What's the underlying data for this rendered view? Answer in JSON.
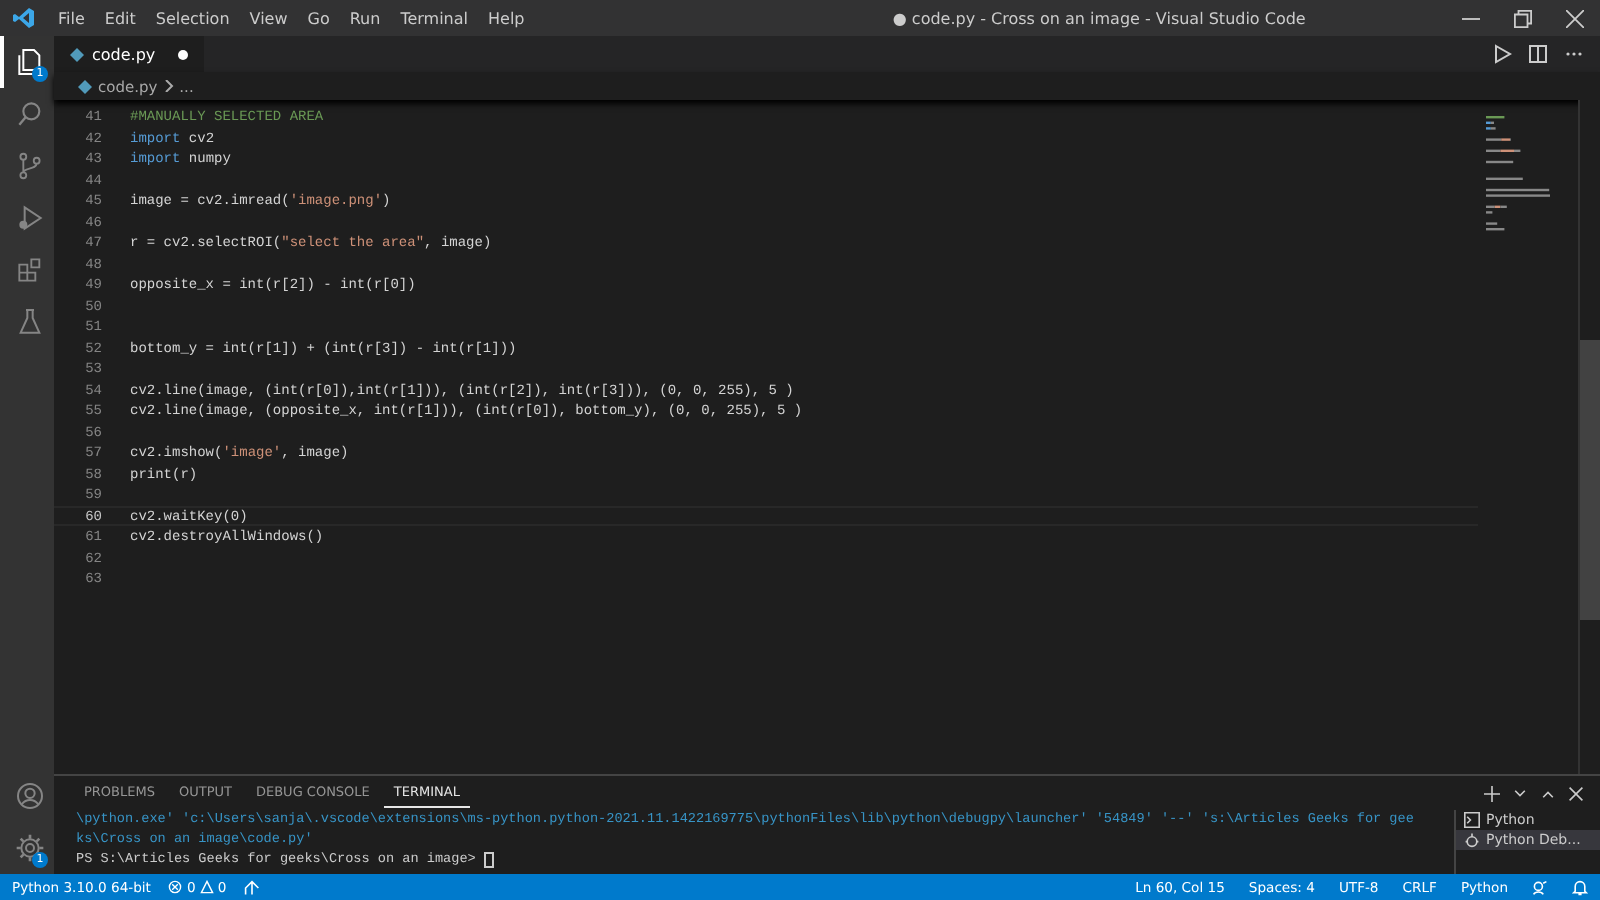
{
  "window": {
    "title": "● code.py - Cross on an image - Visual Studio Code"
  },
  "menu": [
    "File",
    "Edit",
    "Selection",
    "View",
    "Go",
    "Run",
    "Terminal",
    "Help"
  ],
  "activity_bar": {
    "items": [
      {
        "kind": "explorer",
        "badge": "1",
        "selected": true
      },
      {
        "kind": "search",
        "selected": false
      },
      {
        "kind": "source-control",
        "selected": false
      },
      {
        "kind": "run",
        "selected": false
      },
      {
        "kind": "extensions",
        "selected": false
      },
      {
        "kind": "testing",
        "selected": false
      }
    ],
    "bottom": [
      {
        "kind": "account"
      },
      {
        "kind": "settings",
        "badge": "1"
      }
    ]
  },
  "tabs": [
    {
      "label": "code.py",
      "selected": true,
      "modified": true
    }
  ],
  "breadcrumb": [
    "code.py",
    "..."
  ],
  "editor": {
    "lines": [
      {
        "number": "41",
        "current": false,
        "tokens": [
          {
            "text": "#MANUALLY SELECTED AREA",
            "kind": "comment"
          }
        ]
      },
      {
        "number": "42",
        "current": false,
        "tokens": [
          {
            "text": "import",
            "kind": "keyword"
          },
          {
            "text": " cv2",
            "kind": "plain"
          }
        ]
      },
      {
        "number": "43",
        "current": false,
        "tokens": [
          {
            "text": "import",
            "kind": "keyword"
          },
          {
            "text": " numpy",
            "kind": "plain"
          }
        ]
      },
      {
        "number": "44",
        "current": false
      },
      {
        "number": "45",
        "current": false,
        "tokens": [
          {
            "text": "image = cv2.imread(",
            "kind": "plain"
          },
          {
            "text": "'image.png'",
            "kind": "string"
          },
          {
            "text": ")",
            "kind": "plain"
          }
        ]
      },
      {
        "number": "46",
        "current": false
      },
      {
        "number": "47",
        "current": false,
        "tokens": [
          {
            "text": "r = cv2.selectROI(",
            "kind": "plain"
          },
          {
            "text": "\"select the area\"",
            "kind": "string"
          },
          {
            "text": ", image)",
            "kind": "plain"
          }
        ]
      },
      {
        "number": "48",
        "current": false
      },
      {
        "number": "49",
        "current": false,
        "tokens": [
          {
            "text": "opposite_x = int(r[2]) - int(r[0])",
            "kind": "plain"
          }
        ]
      },
      {
        "number": "50",
        "current": false
      },
      {
        "number": "51",
        "current": false
      },
      {
        "number": "52",
        "current": false,
        "tokens": [
          {
            "text": "bottom_y = int(r[1]) + (int(r[3]) - int(r[1]))",
            "kind": "plain"
          }
        ]
      },
      {
        "number": "53",
        "current": false
      },
      {
        "number": "54",
        "current": false,
        "tokens": [
          {
            "text": "cv2.line(image, (int(r[0]),int(r[1])), (int(r[2]), int(r[3])), (0, 0, 255), 5 )",
            "kind": "plain"
          }
        ]
      },
      {
        "number": "55",
        "current": false,
        "tokens": [
          {
            "text": "cv2.line(image, (opposite_x, int(r[1])), (int(r[0]), bottom_y), (0, 0, 255), 5 )",
            "kind": "plain"
          }
        ]
      },
      {
        "number": "56",
        "current": false
      },
      {
        "number": "57",
        "current": false,
        "tokens": [
          {
            "text": "cv2.imshow(",
            "kind": "plain"
          },
          {
            "text": "'image'",
            "kind": "string"
          },
          {
            "text": ", image)",
            "kind": "plain"
          }
        ]
      },
      {
        "number": "58",
        "current": false,
        "tokens": [
          {
            "text": "print(r)",
            "kind": "plain"
          }
        ]
      },
      {
        "number": "59",
        "current": false
      },
      {
        "number": "60",
        "current": true,
        "tokens": [
          {
            "text": "cv2.waitKey(0)",
            "kind": "plain"
          }
        ]
      },
      {
        "number": "61",
        "current": false,
        "tokens": [
          {
            "text": "cv2.destroyAllWindows()",
            "kind": "plain"
          }
        ]
      },
      {
        "number": "62",
        "current": false
      },
      {
        "number": "63",
        "current": false
      }
    ]
  },
  "panel": {
    "tabs": [
      {
        "label": "PROBLEMS",
        "selected": false
      },
      {
        "label": "OUTPUT",
        "selected": false
      },
      {
        "label": "DEBUG CONSOLE",
        "selected": false
      },
      {
        "label": "TERMINAL",
        "selected": true
      }
    ],
    "terminal_lines": [
      {
        "text": "\\python.exe' 'c:\\Users\\sanja\\.vscode\\extensions\\ms-python.python-2021.11.1422169775\\pythonFiles\\lib\\python\\debugpy\\launcher' '54849' '--' 's:\\Articles Geeks for gee",
        "kind": "output"
      },
      {
        "text": "ks\\Cross on an image\\code.py'",
        "kind": "output"
      },
      {
        "text": "PS S:\\Articles Geeks for geeks\\Cross on an image> ",
        "kind": "prompt"
      }
    ],
    "terminals": [
      {
        "label": "Python",
        "kind": "shell",
        "selected": false
      },
      {
        "label": "Python Deb...",
        "kind": "debug",
        "selected": true
      }
    ]
  },
  "status_bar": {
    "interpreter": "Python 3.10.0 64-bit",
    "errors": "0",
    "warnings": "0",
    "right": [
      "Ln 60, Col 15",
      "Spaces: 4",
      "UTF-8",
      "CRLF",
      "Python"
    ]
  }
}
